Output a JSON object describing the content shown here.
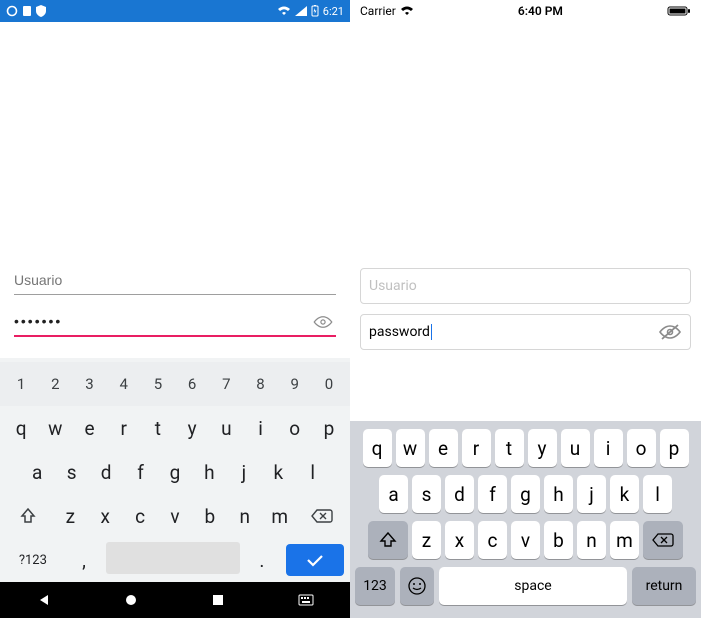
{
  "android": {
    "status": {
      "time": "6:21"
    },
    "usernameField": {
      "placeholder": "Usuario"
    },
    "passwordField": {
      "value": "•••••••"
    },
    "keyboard": {
      "numrow": [
        "1",
        "2",
        "3",
        "4",
        "5",
        "6",
        "7",
        "8",
        "9",
        "0"
      ],
      "row1": [
        "q",
        "w",
        "e",
        "r",
        "t",
        "y",
        "u",
        "i",
        "o",
        "p"
      ],
      "row2": [
        "a",
        "s",
        "d",
        "f",
        "g",
        "h",
        "j",
        "k",
        "l"
      ],
      "row3": [
        "z",
        "x",
        "c",
        "v",
        "b",
        "n",
        "m"
      ],
      "symKey": "?123",
      "commaKey": ",",
      "periodKey": "."
    }
  },
  "ios": {
    "status": {
      "carrier": "Carrier",
      "time": "6:40 PM"
    },
    "usernameField": {
      "placeholder": "Usuario"
    },
    "passwordField": {
      "value": "password"
    },
    "keyboard": {
      "row1": [
        "q",
        "w",
        "e",
        "r",
        "t",
        "y",
        "u",
        "i",
        "o",
        "p"
      ],
      "row2": [
        "a",
        "s",
        "d",
        "f",
        "g",
        "h",
        "j",
        "k",
        "l"
      ],
      "row3": [
        "z",
        "x",
        "c",
        "v",
        "b",
        "n",
        "m"
      ],
      "numKey": "123",
      "spaceKey": "space",
      "returnKey": "return"
    }
  }
}
